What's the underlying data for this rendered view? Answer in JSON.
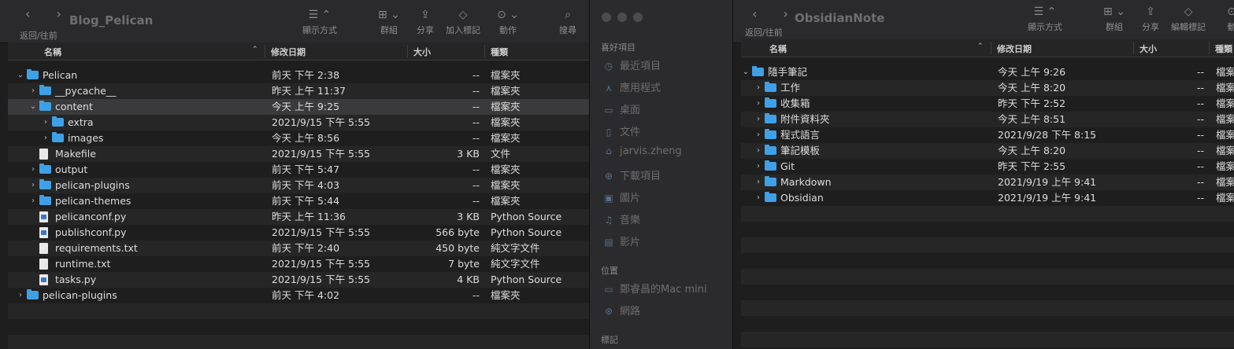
{
  "left": {
    "title": "Blog_Pelican",
    "nav_caption": "返回/往前",
    "toolbar": [
      "顯示方式",
      "群組",
      "分享",
      "加入標記",
      "動作",
      "搜尋"
    ],
    "columns": [
      "名稱",
      "修改日期",
      "大小",
      "種類"
    ],
    "rows": [
      {
        "indent": 0,
        "disc": "open",
        "icon": "folder",
        "name": "Pelican",
        "date": "前天 下午 2:38",
        "size": "--",
        "kind": "檔案夾"
      },
      {
        "indent": 1,
        "disc": "closed",
        "icon": "folder",
        "name": "__pycache__",
        "date": "昨天 上午 11:37",
        "size": "--",
        "kind": "檔案夾"
      },
      {
        "indent": 1,
        "disc": "open",
        "icon": "folder",
        "name": "content",
        "date": "今天 上午 9:25",
        "size": "--",
        "kind": "檔案夾",
        "selected": true
      },
      {
        "indent": 2,
        "disc": "closed",
        "icon": "folder",
        "name": "extra",
        "date": "2021/9/15 下午 5:55",
        "size": "--",
        "kind": "檔案夾"
      },
      {
        "indent": 2,
        "disc": "closed",
        "icon": "folder",
        "name": "images",
        "date": "今天 上午 8:56",
        "size": "--",
        "kind": "檔案夾"
      },
      {
        "indent": 1,
        "disc": "none",
        "icon": "file",
        "name": "Makefile",
        "date": "2021/9/15 下午 5:55",
        "size": "3 KB",
        "kind": "文件"
      },
      {
        "indent": 1,
        "disc": "closed",
        "icon": "folder",
        "name": "output",
        "date": "前天 下午 5:47",
        "size": "--",
        "kind": "檔案夾"
      },
      {
        "indent": 1,
        "disc": "closed",
        "icon": "folder",
        "name": "pelican-plugins",
        "date": "前天 下午 4:03",
        "size": "--",
        "kind": "檔案夾"
      },
      {
        "indent": 1,
        "disc": "closed",
        "icon": "folder",
        "name": "pelican-themes",
        "date": "前天 下午 5:44",
        "size": "--",
        "kind": "檔案夾"
      },
      {
        "indent": 1,
        "disc": "none",
        "icon": "pyfile",
        "name": "pelicanconf.py",
        "date": "昨天 上午 11:36",
        "size": "3 KB",
        "kind": "Python Source"
      },
      {
        "indent": 1,
        "disc": "none",
        "icon": "pyfile",
        "name": "publishconf.py",
        "date": "2021/9/15 下午 5:55",
        "size": "566 byte",
        "kind": "Python Source"
      },
      {
        "indent": 1,
        "disc": "none",
        "icon": "file",
        "name": "requirements.txt",
        "date": "前天 下午 2:40",
        "size": "450 byte",
        "kind": "純文字文件"
      },
      {
        "indent": 1,
        "disc": "none",
        "icon": "file",
        "name": "runtime.txt",
        "date": "2021/9/15 下午 5:55",
        "size": "7 byte",
        "kind": "純文字文件"
      },
      {
        "indent": 1,
        "disc": "none",
        "icon": "pyfile",
        "name": "tasks.py",
        "date": "2021/9/15 下午 5:55",
        "size": "4 KB",
        "kind": "Python Source"
      },
      {
        "indent": 0,
        "disc": "closed",
        "icon": "folder",
        "name": "pelican-plugins",
        "date": "前天 下午 4:02",
        "size": "--",
        "kind": "檔案夾"
      }
    ]
  },
  "sidebar": {
    "favorites_title": "喜好項目",
    "favorites": [
      {
        "icon": "clock-icon",
        "glyph": "◷",
        "label": "最近項目"
      },
      {
        "icon": "apps-icon",
        "glyph": "⋏",
        "label": "應用程式"
      },
      {
        "icon": "desktop-icon",
        "glyph": "▭",
        "label": "桌面"
      },
      {
        "icon": "document-icon",
        "glyph": "▯",
        "label": "文件"
      },
      {
        "icon": "home-icon",
        "glyph": "⌂",
        "label": "jarvis.zheng"
      },
      {
        "icon": "download-icon",
        "glyph": "⊕",
        "label": "下載項目"
      },
      {
        "icon": "photos-icon",
        "glyph": "▣",
        "label": "圖片"
      },
      {
        "icon": "music-icon",
        "glyph": "♫",
        "label": "音樂"
      },
      {
        "icon": "movies-icon",
        "glyph": "▤",
        "label": "影片"
      }
    ],
    "locations_title": "位置",
    "locations": [
      {
        "icon": "computer-icon",
        "glyph": "▭",
        "label": "鄭睿昌的Mac mini"
      },
      {
        "icon": "network-icon",
        "glyph": "⊛",
        "label": "網路"
      }
    ],
    "tags_title": "標記"
  },
  "right": {
    "title": "ObsidianNote",
    "nav_caption": "返回/往前",
    "toolbar": [
      "顯示方式",
      "群組",
      "分享",
      "編輯標記",
      "動"
    ],
    "columns": [
      "名稱",
      "修改日期",
      "大小",
      "種類"
    ],
    "rows": [
      {
        "indent": 0,
        "disc": "open",
        "icon": "folder",
        "name": "隨手筆記",
        "date": "今天 上午 9:26",
        "size": "--",
        "kind": "檔案"
      },
      {
        "indent": 1,
        "disc": "closed",
        "icon": "folder",
        "name": "工作",
        "date": "今天 上午 8:20",
        "size": "--",
        "kind": "檔案"
      },
      {
        "indent": 1,
        "disc": "closed",
        "icon": "folder",
        "name": "收集箱",
        "date": "昨天 下午 2:52",
        "size": "--",
        "kind": "檔案"
      },
      {
        "indent": 1,
        "disc": "closed",
        "icon": "folder",
        "name": "附件資料夾",
        "date": "今天 上午 8:51",
        "size": "--",
        "kind": "檔案"
      },
      {
        "indent": 1,
        "disc": "closed",
        "icon": "folder",
        "name": "程式語言",
        "date": "2021/9/28 下午 8:15",
        "size": "--",
        "kind": "檔案"
      },
      {
        "indent": 1,
        "disc": "closed",
        "icon": "folder",
        "name": "筆記模板",
        "date": "今天 上午 8:20",
        "size": "--",
        "kind": "檔案"
      },
      {
        "indent": 1,
        "disc": "closed",
        "icon": "folder",
        "name": "Git",
        "date": "昨天 下午 2:55",
        "size": "--",
        "kind": "檔案"
      },
      {
        "indent": 1,
        "disc": "closed",
        "icon": "folder",
        "name": "Markdown",
        "date": "2021/9/19 上午 9:41",
        "size": "--",
        "kind": "檔案"
      },
      {
        "indent": 1,
        "disc": "closed",
        "icon": "folder",
        "name": "Obsidian",
        "date": "2021/9/19 上午 9:41",
        "size": "--",
        "kind": "檔案"
      }
    ]
  }
}
